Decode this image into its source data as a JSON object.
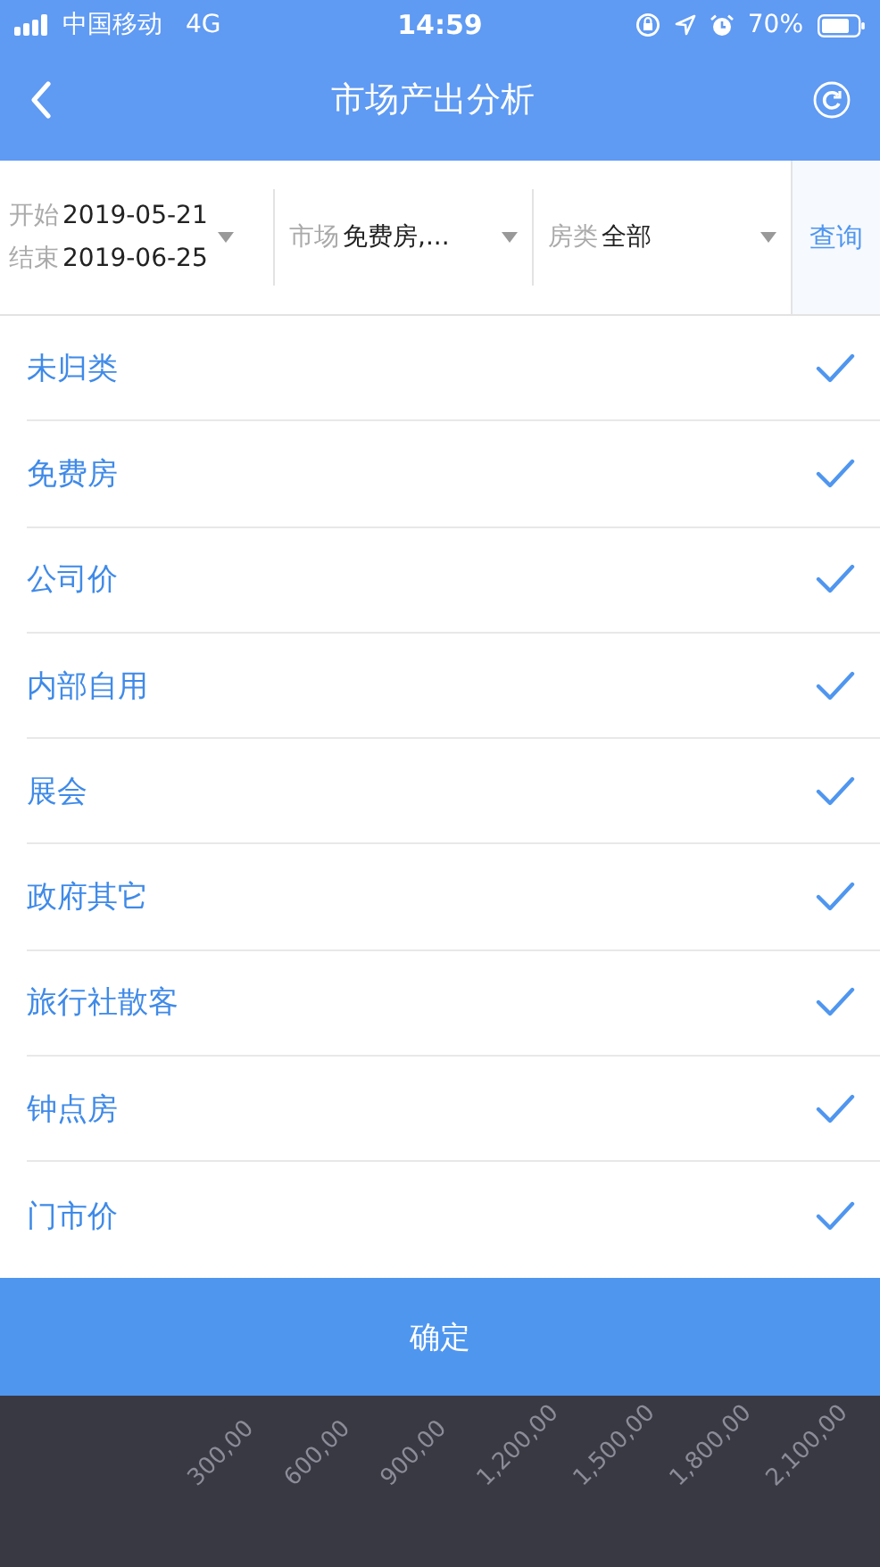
{
  "status_bar": {
    "carrier": "中国移动",
    "network": "4G",
    "time": "14:59",
    "battery": "70%"
  },
  "nav": {
    "title": "市场产出分析"
  },
  "filters": {
    "start_label": "开始",
    "start_value": "2019-05-21",
    "end_label": "结束",
    "end_value": "2019-06-25",
    "market_label": "市场",
    "market_value": "免费房,...",
    "room_label": "房类",
    "room_value": "全部",
    "query_button": "查询"
  },
  "options": [
    {
      "label": "未归类",
      "checked": true
    },
    {
      "label": "免费房",
      "checked": true
    },
    {
      "label": "公司价",
      "checked": true
    },
    {
      "label": "内部自用",
      "checked": true
    },
    {
      "label": "展会",
      "checked": true
    },
    {
      "label": "政府其它",
      "checked": true
    },
    {
      "label": "旅行社散客",
      "checked": true
    },
    {
      "label": "钟点房",
      "checked": true
    },
    {
      "label": "门市价",
      "checked": true
    }
  ],
  "confirm_button": "确定",
  "axis_labels": [
    "300,00",
    "600,00",
    "900,00",
    "1,200,00",
    "1,500,00",
    "1,800,00",
    "2,100,00"
  ]
}
